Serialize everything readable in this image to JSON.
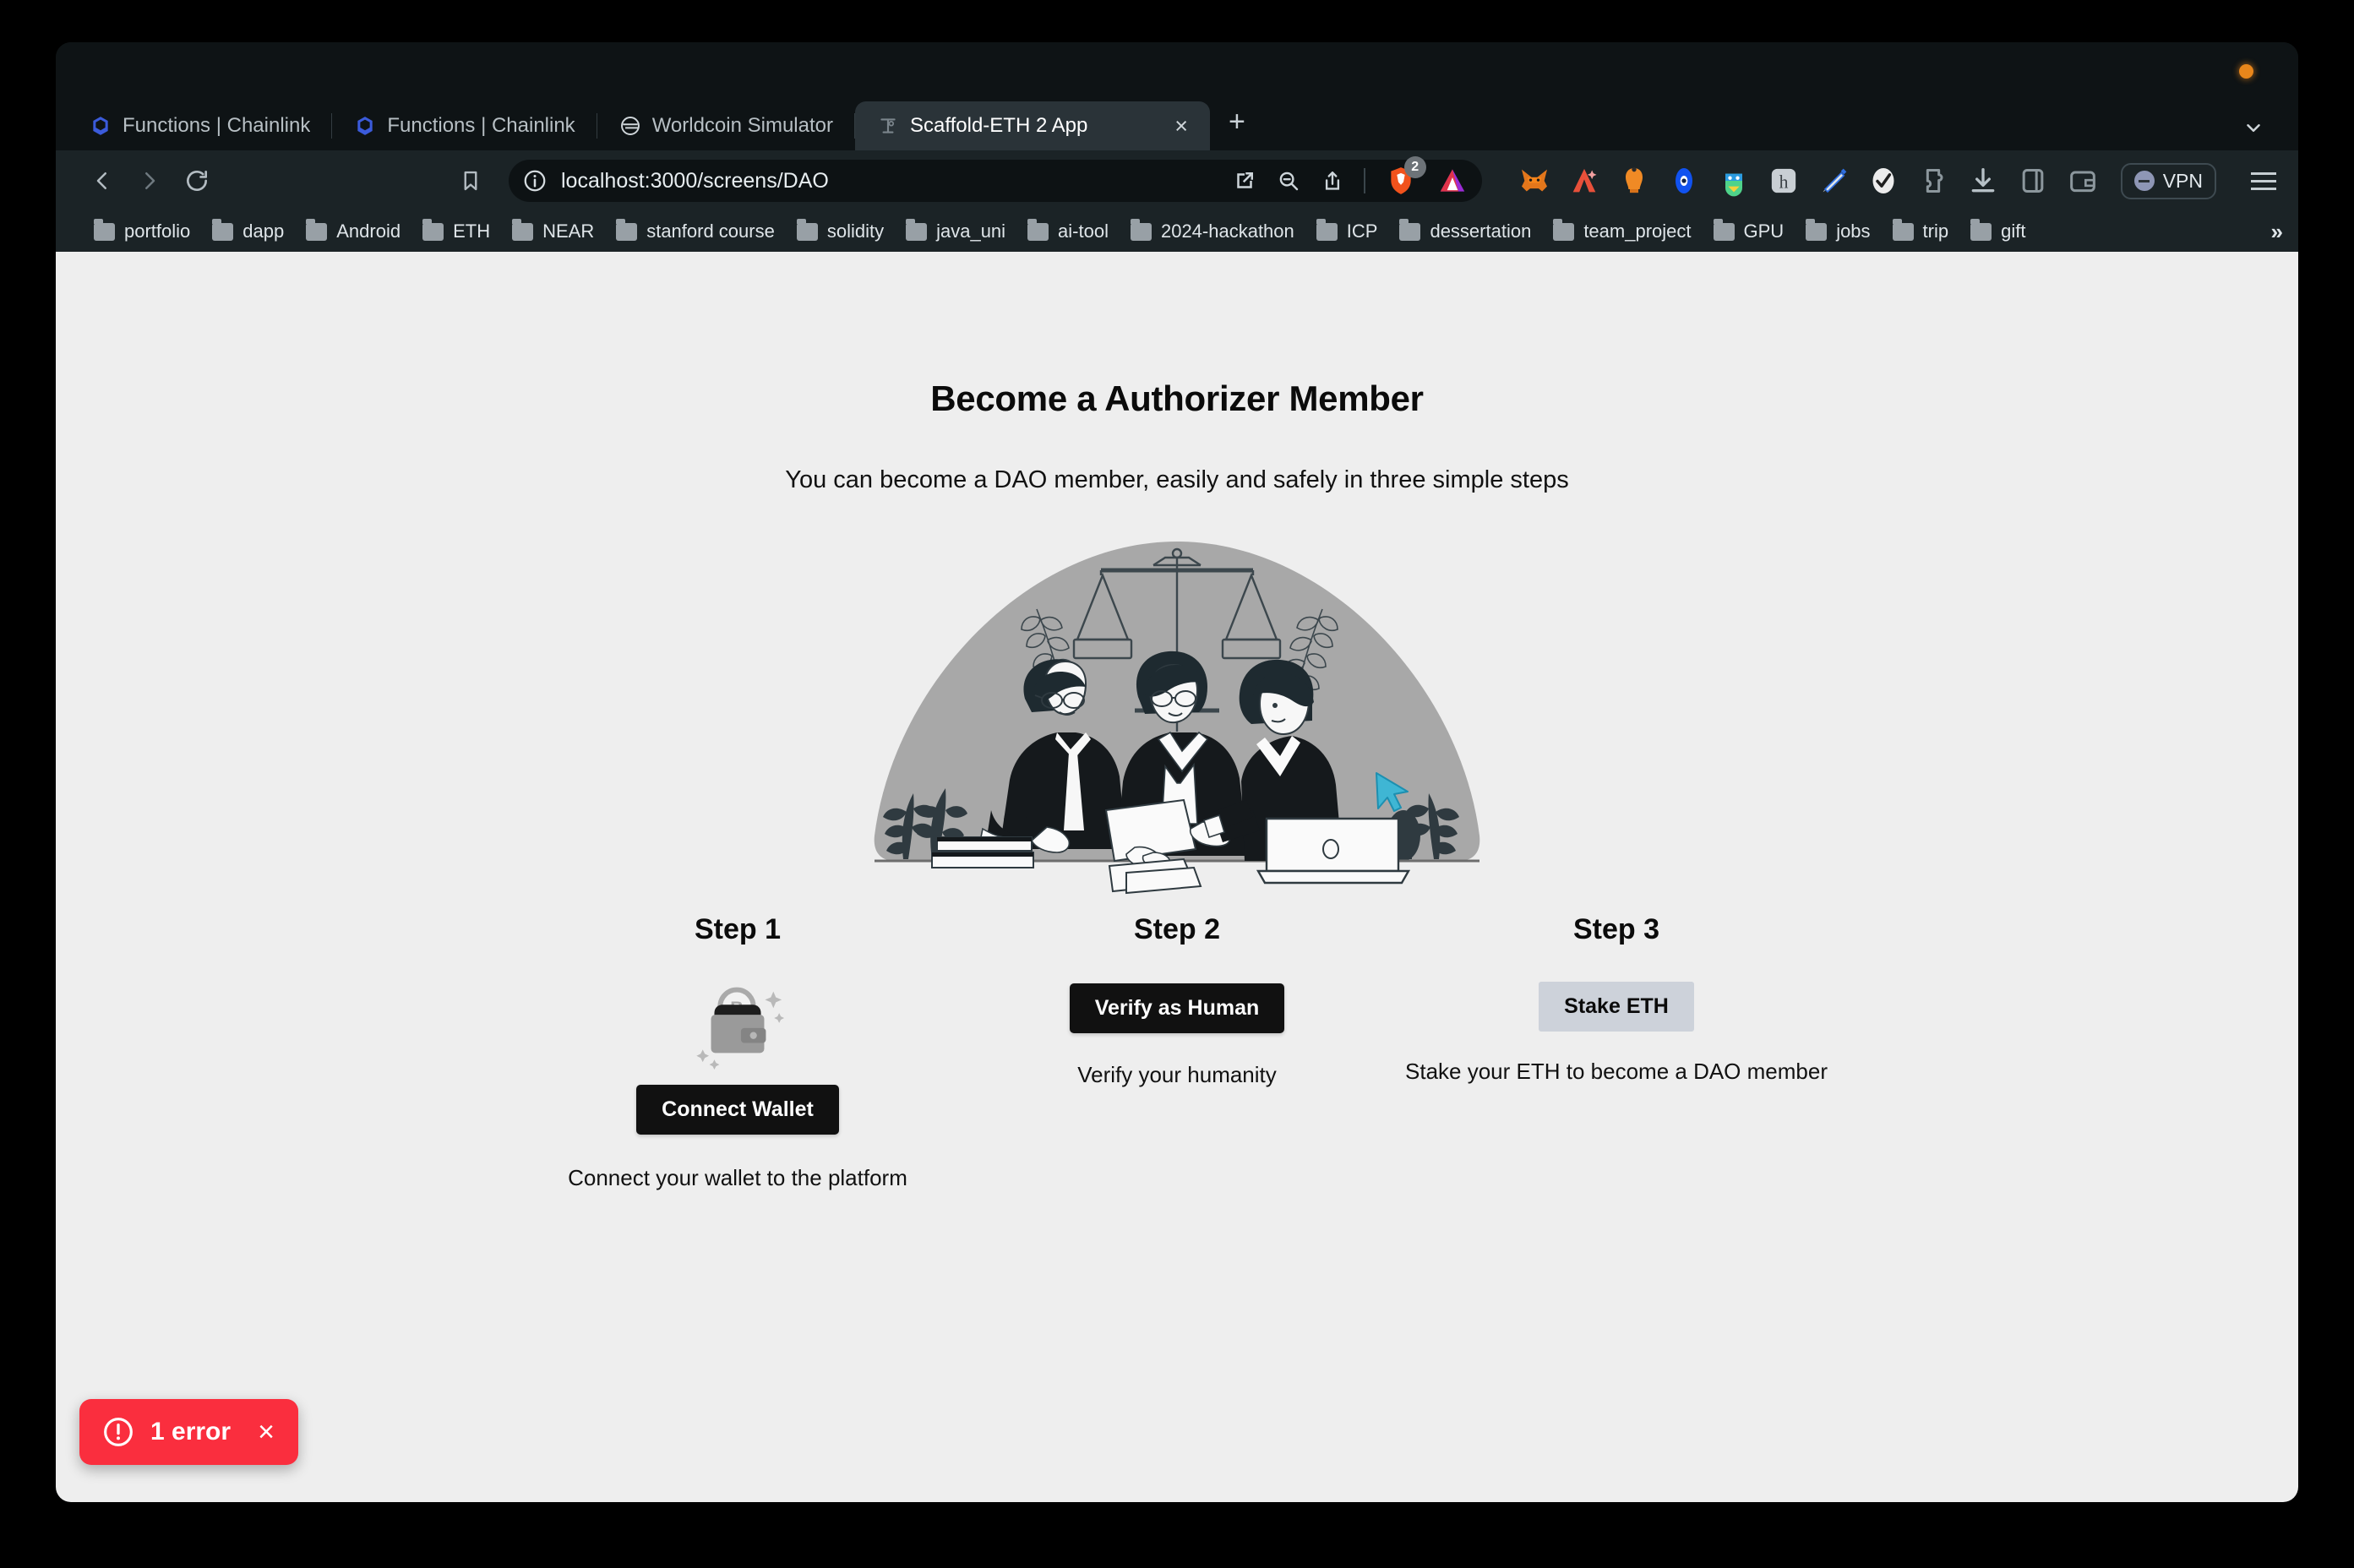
{
  "browser": {
    "window_dot_color": "#e8861b",
    "tabs": [
      {
        "title": "Functions | Chainlink",
        "favicon": "chainlink-icon",
        "active": false
      },
      {
        "title": "Functions | Chainlink",
        "favicon": "chainlink-icon",
        "active": false
      },
      {
        "title": "Worldcoin Simulator",
        "favicon": "worldcoin-icon",
        "active": false
      },
      {
        "title": "Scaffold-ETH 2 App",
        "favicon": "scaffold-eth-icon",
        "active": true
      }
    ],
    "new_tab_label": "+",
    "tab_close_label": "×",
    "nav": {
      "back": "‹",
      "forward": "›",
      "reload": "reload-icon",
      "bookmark": "bookmark-icon"
    },
    "omnibox": {
      "info_icon": "info-circle-icon",
      "url": "localhost:3000/screens/DAO",
      "open_in_app_icon": "open-in-app-icon",
      "zoom_out_icon": "zoom-out-icon",
      "share_icon": "share-icon",
      "shield_icon": "brave-shield-icon",
      "shield_badge": "2",
      "bat_icon": "bat-triangle-icon"
    },
    "extensions": [
      "metamask-fox-icon",
      "rainbow-a-icon",
      "orange-wallet-icon",
      "blue-eye-icon",
      "colorful-face-icon",
      "h-letter-icon",
      "pen-icon",
      "checkmark-icon",
      "puzzle-piece-icon",
      "download-icon",
      "sidebar-icon",
      "wallet-icon"
    ],
    "vpn_label": "VPN",
    "menu_icon": "hamburger-menu-icon",
    "bookmarks": [
      "portfolio",
      "dapp",
      "Android",
      "ETH",
      "NEAR",
      "stanford course",
      "solidity",
      "java_uni",
      "ai-tool",
      "2024-hackathon",
      "ICP",
      "dessertation",
      "team_project",
      "GPU",
      "jobs",
      "trip",
      "gift"
    ],
    "bookmarks_overflow": "»"
  },
  "page": {
    "title": "Become a Authorizer Member",
    "subtitle": "You can become a DAO member, easily and safely in three simple steps",
    "illustration_name": "dao-meeting-illustration",
    "steps": [
      {
        "title": "Step 1",
        "icon": "bitcoin-wallet-icon",
        "button": "Connect Wallet",
        "button_style": "dark",
        "description": "Connect your wallet to the platform"
      },
      {
        "title": "Step 2",
        "button": "Verify as Human",
        "button_style": "dark",
        "description": "Verify your humanity"
      },
      {
        "title": "Step 3",
        "button": "Stake ETH",
        "button_style": "muted",
        "description": "Stake your ETH to become a DAO member"
      }
    ],
    "toast": {
      "icon": "error-circle-icon",
      "text": "1 error",
      "close": "×",
      "color": "#fa2e3e"
    }
  }
}
